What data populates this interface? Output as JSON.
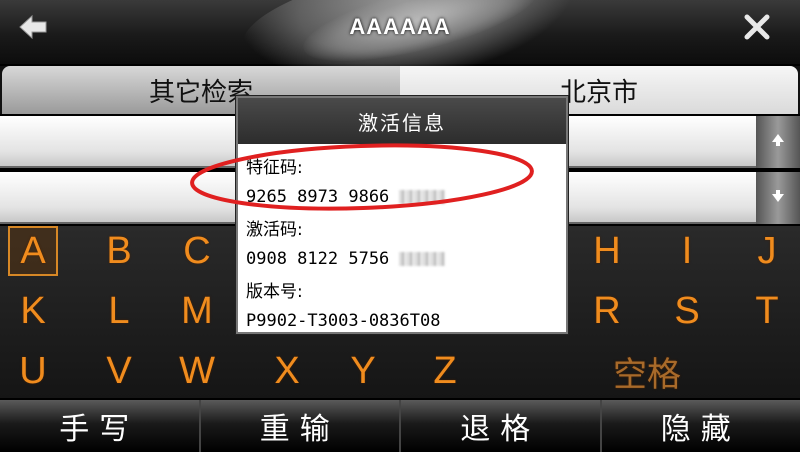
{
  "header": {
    "title": "AAAAAA",
    "back_icon": "back-arrow-icon",
    "close_icon": "close-icon"
  },
  "tabs": [
    {
      "label": "其它检索"
    },
    {
      "label": "北京市"
    }
  ],
  "scroll_icons": [
    "scroll-up-icon",
    "scroll-down-icon"
  ],
  "keyboard": {
    "row1": [
      "A",
      "B",
      "C",
      "H",
      "I",
      "J"
    ],
    "row2": [
      "K",
      "L",
      "M",
      "R",
      "S",
      "T"
    ],
    "row3": [
      "U",
      "V",
      "W",
      "X",
      "Y",
      "Z"
    ],
    "space_label": "空格",
    "selected_key": "A",
    "key_color": "#f08c1e"
  },
  "bottom_bar": {
    "handwrite": "手写",
    "reinput": "重输",
    "backspace": "退格",
    "hide": "隐藏"
  },
  "dialog": {
    "title": "激活信息",
    "feature_code_label": "特征码:",
    "feature_code_value": "9265 8973 9866",
    "activation_code_label": "激活码:",
    "activation_code_value": "0908 8122 5756",
    "version_label": "版本号:",
    "version_value": "P9902-T3003-0836T08"
  },
  "annotation": {
    "color": "#e02020"
  }
}
